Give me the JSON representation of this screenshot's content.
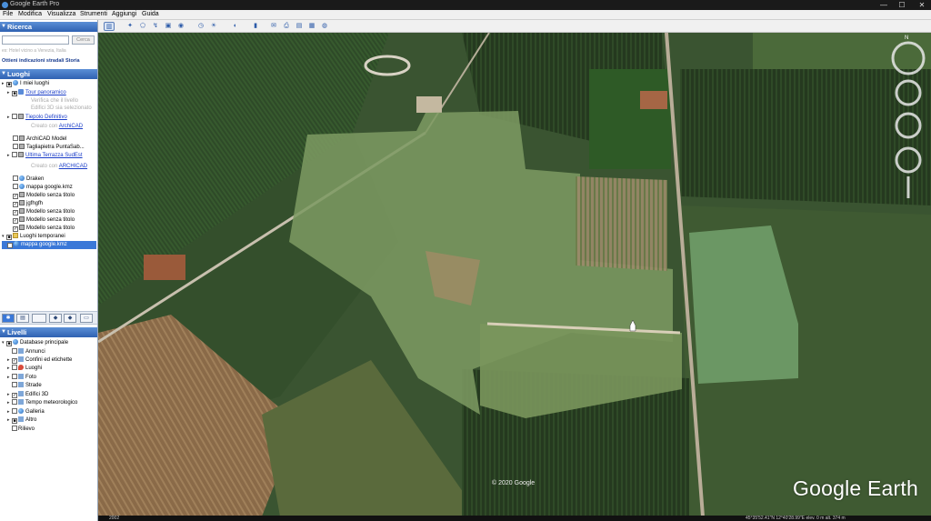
{
  "window": {
    "title": "Google Earth Pro",
    "minimize": "—",
    "maximize": "☐",
    "close": "✕"
  },
  "menu": [
    "File",
    "Modifica",
    "Visualizza",
    "Strumenti",
    "Aggiungi",
    "Guida"
  ],
  "search": {
    "header": "Ricerca",
    "input_value": "",
    "button": "Cerca",
    "hint": "es: Hotel vicino a Venezia, Italia",
    "links": "Ottieni indicazioni stradali  Storia"
  },
  "places": {
    "header": "Luoghi",
    "items": [
      {
        "label": "I miei luoghi",
        "icon": "globe-icon"
      },
      {
        "label": "Tour panoramico",
        "icon": "tour-icon",
        "link": true
      },
      {
        "label": "Verifica che il livello",
        "gray": true
      },
      {
        "label": "Edifici 3D sia selezionato",
        "gray": true
      },
      {
        "label": "Tiepolo Definitivo",
        "icon": "model-icon",
        "link": true
      },
      {
        "label": "Creato con",
        "gray": true,
        "suffix": "ArchiCAD"
      },
      {
        "label": "ArchiCAD Model",
        "icon": "model-icon"
      },
      {
        "label": "Tagliapietra PuntaSab...",
        "icon": "model-icon"
      },
      {
        "label": "Ultima Terrazza SudEst",
        "icon": "model-icon",
        "link": true
      },
      {
        "label": "Creato con",
        "gray": true,
        "suffix": "ARCHICAD"
      },
      {
        "label": "Draken",
        "icon": "globe-icon"
      },
      {
        "label": "mappa google.kmz",
        "icon": "globe-icon"
      },
      {
        "label": "Modello senza titolo",
        "icon": "model-icon"
      },
      {
        "label": "jgfhgfh",
        "icon": "model-icon"
      },
      {
        "label": "Modello senza titolo",
        "icon": "model-icon"
      },
      {
        "label": "Modello senza titolo",
        "icon": "model-icon"
      },
      {
        "label": "Modello senza titolo",
        "icon": "model-icon"
      },
      {
        "label": "Luoghi temporanei",
        "icon": "folder-icon"
      },
      {
        "label": "mappa google.kmz",
        "icon": "globe-icon",
        "selected": true
      }
    ]
  },
  "layers": {
    "header": "Livelli",
    "items": [
      {
        "label": "Database principale",
        "icon": "globe-icon"
      },
      {
        "label": "Annunci",
        "icon": "layer-icon"
      },
      {
        "label": "Confini ed etichette",
        "icon": "layer-icon"
      },
      {
        "label": "Luoghi",
        "icon": "pin-icon"
      },
      {
        "label": "Foto",
        "icon": "layer-icon"
      },
      {
        "label": "Strade",
        "icon": "layer-icon"
      },
      {
        "label": "Edifici 3D",
        "icon": "layer-icon"
      },
      {
        "label": "Tempo meteorologico",
        "icon": "layer-icon"
      },
      {
        "label": "Galleria",
        "icon": "layer-icon"
      },
      {
        "label": "Altro",
        "icon": "layer-icon"
      },
      {
        "label": "Rilievo",
        "icon": "layer-icon"
      }
    ]
  },
  "map": {
    "copyright": "© 2020 Google",
    "logo": "Google Earth",
    "compass_north": "N"
  },
  "status": {
    "year": "2002",
    "coords": "45°35'52.41\"N   12°40'28.99\"E   elev.   0 m   alt.   374 m"
  }
}
